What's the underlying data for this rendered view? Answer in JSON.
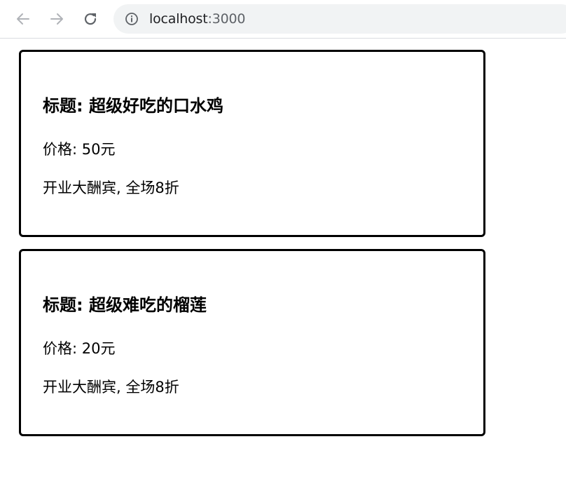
{
  "browser": {
    "url_host": "localhost",
    "url_port": ":3000",
    "icons": {
      "back": "arrow-left-icon",
      "forward": "arrow-right-icon",
      "reload": "reload-icon",
      "info": "info-icon"
    },
    "colors": {
      "icon_disabled": "#b0b3b8",
      "icon_active": "#5f6368",
      "omnibox_bg": "#f1f3f4"
    }
  },
  "cards": [
    {
      "title": "标题: 超级好吃的口水鸡",
      "price": "价格: 50元",
      "promo": "开业大酬宾, 全场8折"
    },
    {
      "title": "标题: 超级难吃的榴莲",
      "price": "价格: 20元",
      "promo": "开业大酬宾, 全场8折"
    }
  ]
}
